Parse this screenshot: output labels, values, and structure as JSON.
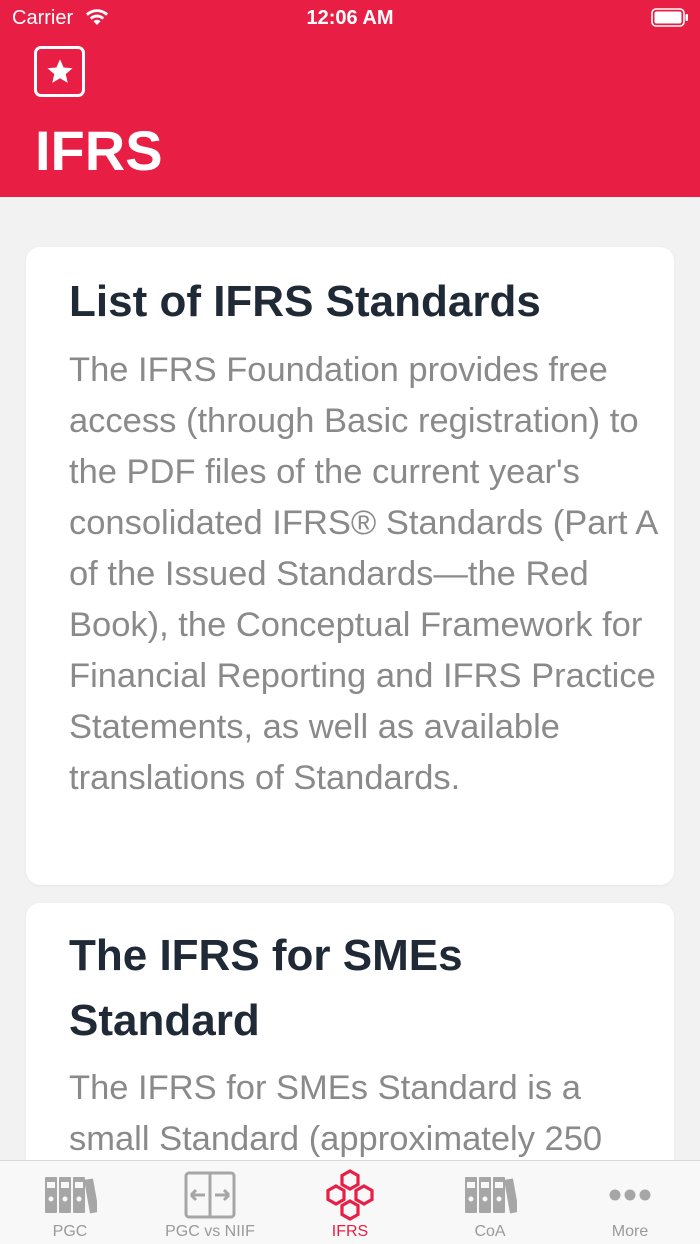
{
  "status_bar": {
    "carrier": "Carrier",
    "time": "12:06 AM"
  },
  "header": {
    "title": "IFRS",
    "favorite_icon": "star-icon",
    "background_color": "#e81e45"
  },
  "cards": [
    {
      "title": "List of IFRS Standards",
      "body": "The IFRS Foundation provides free access (through Basic registration) to the PDF files of the current year's consolidated IFRS® Standards (Part A of the Issued Standards—the Red Book), the Conceptual Framework for Financial Reporting and IFRS Practice Statements, as well as available translations of Standards."
    },
    {
      "title": "The IFRS for SMEs Standard",
      "body": "The IFRS for SMEs Standard is a small Standard (approximately 250"
    }
  ],
  "tabbar": {
    "active_color": "#e81e45",
    "inactive_color": "#9a9a9a",
    "items": [
      {
        "label": "PGC",
        "icon": "binders-icon",
        "active": false
      },
      {
        "label": "PGC vs NIIF",
        "icon": "compare-arrows-icon",
        "active": false
      },
      {
        "label": "IFRS",
        "icon": "hexagon-cluster-icon",
        "active": true
      },
      {
        "label": "CoA",
        "icon": "binders-icon",
        "active": false
      },
      {
        "label": "More",
        "icon": "more-dots-icon",
        "active": false
      }
    ]
  }
}
